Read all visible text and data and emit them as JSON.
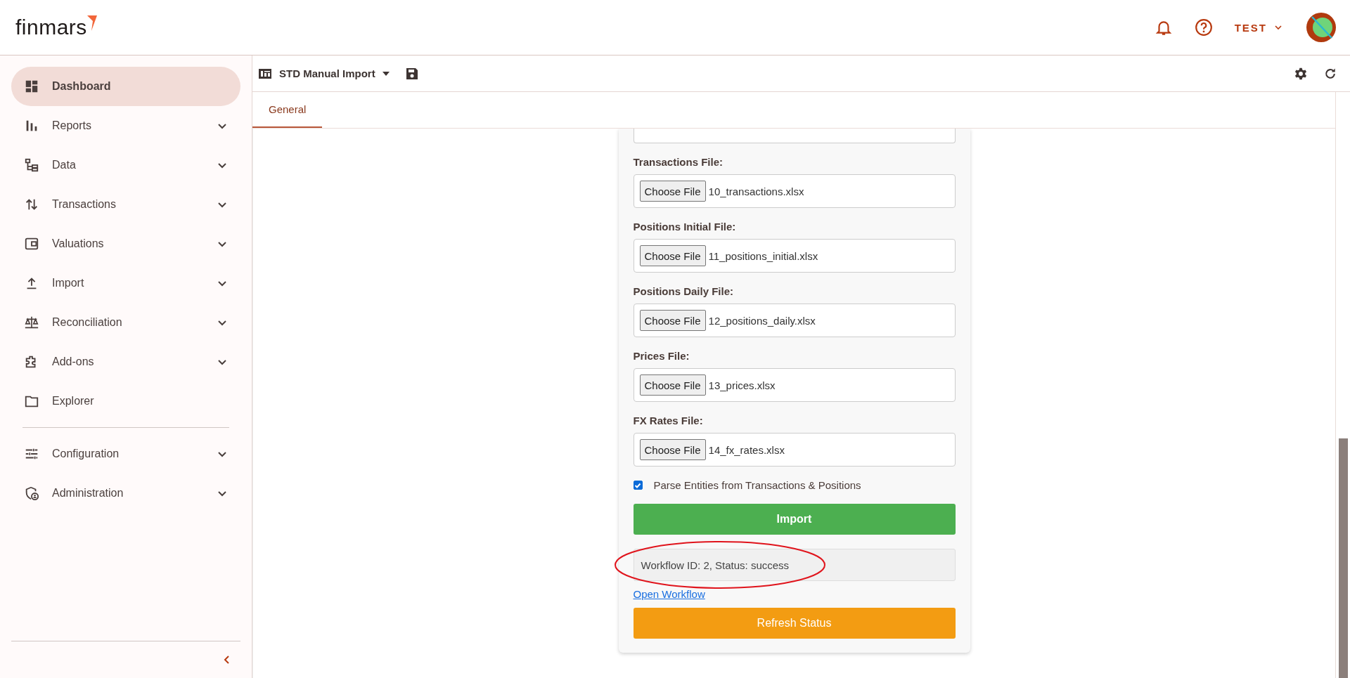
{
  "header": {
    "logo": "finmars",
    "user": "TEST"
  },
  "sidebar": {
    "items": [
      {
        "label": "Dashboard",
        "selected": true,
        "expandable": false
      },
      {
        "label": "Reports",
        "selected": false,
        "expandable": true
      },
      {
        "label": "Data",
        "selected": false,
        "expandable": true
      },
      {
        "label": "Transactions",
        "selected": false,
        "expandable": true
      },
      {
        "label": "Valuations",
        "selected": false,
        "expandable": true
      },
      {
        "label": "Import",
        "selected": false,
        "expandable": true
      },
      {
        "label": "Reconciliation",
        "selected": false,
        "expandable": true
      },
      {
        "label": "Add-ons",
        "selected": false,
        "expandable": true
      },
      {
        "label": "Explorer",
        "selected": false,
        "expandable": false
      }
    ],
    "settings_items": [
      {
        "label": "Configuration",
        "selected": false,
        "expandable": true
      },
      {
        "label": "Administration",
        "selected": false,
        "expandable": true
      }
    ]
  },
  "toolbar": {
    "layout_name": "STD Manual Import"
  },
  "tabs": [
    {
      "label": "General",
      "selected": true
    }
  ],
  "form": {
    "fields": [
      {
        "label": "Transactions File:",
        "button": "Choose File",
        "file": "10_transactions.xlsx"
      },
      {
        "label": "Positions Initial File:",
        "button": "Choose File",
        "file": "11_positions_initial.xlsx"
      },
      {
        "label": "Positions Daily File:",
        "button": "Choose File",
        "file": "12_positions_daily.xlsx"
      },
      {
        "label": "Prices File:",
        "button": "Choose File",
        "file": "13_prices.xlsx"
      },
      {
        "label": "FX Rates File:",
        "button": "Choose File",
        "file": "14_fx_rates.xlsx"
      }
    ],
    "checkbox": {
      "label": "Parse Entities from Transactions & Positions",
      "checked": true
    },
    "import_button": "Import",
    "status": "Workflow ID: 2, Status: success",
    "link": "Open Workflow",
    "refresh_button": "Refresh Status"
  }
}
